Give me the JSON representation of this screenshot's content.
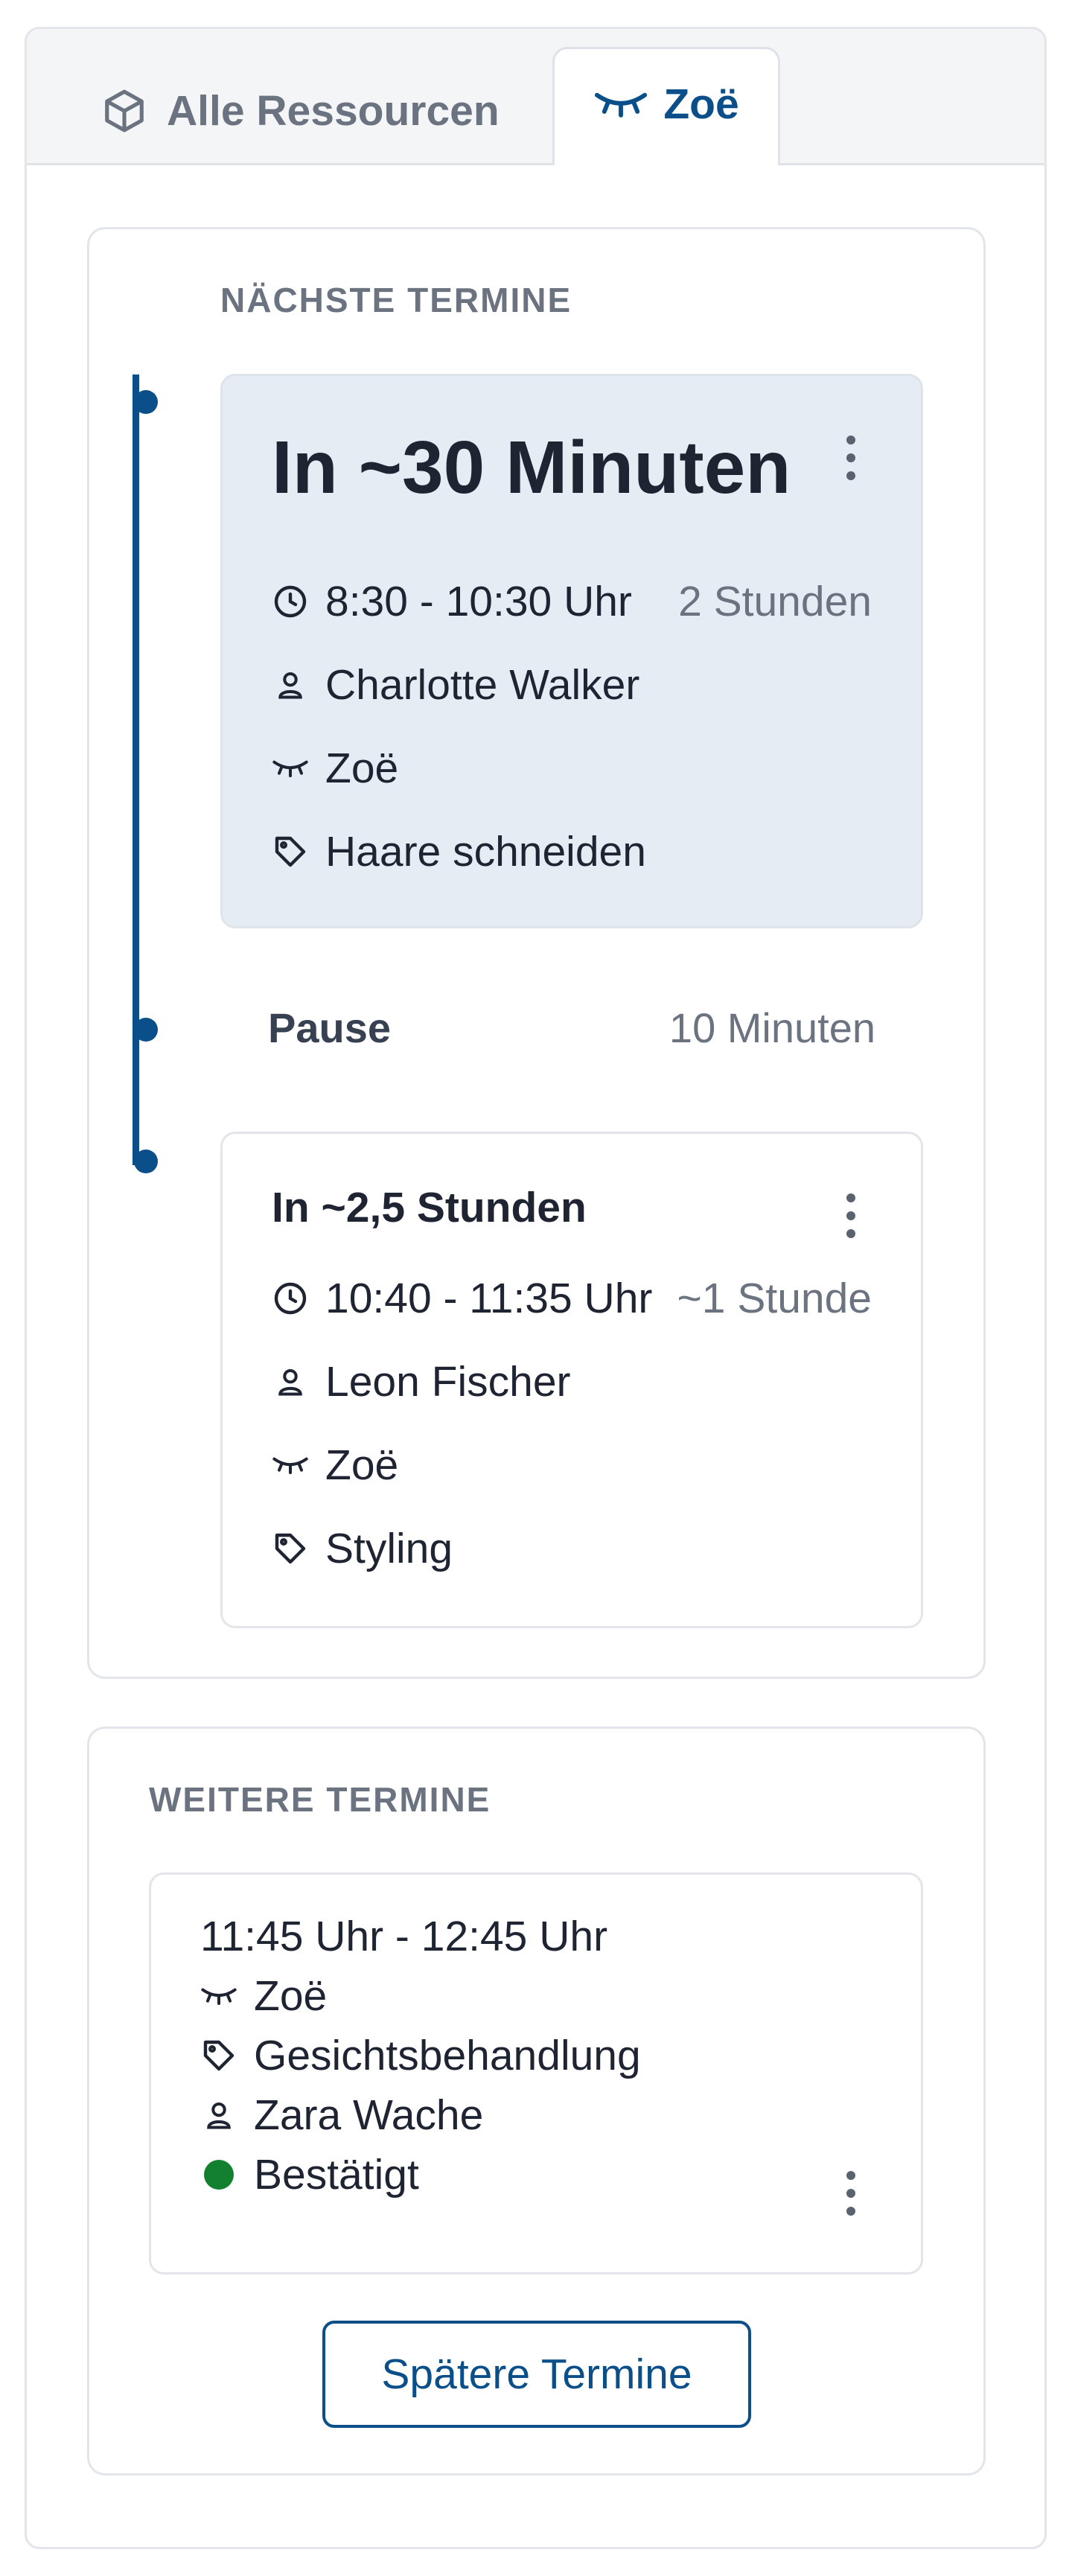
{
  "tabs": {
    "all_label": "Alle Ressourcen",
    "active_label": "Zoë"
  },
  "next_section": {
    "title": "NÄCHSTE TERMINE",
    "first": {
      "heading": "In ~30 Minuten",
      "time": "8:30 - 10:30 Uhr",
      "duration": "2 Stunden",
      "customer": "Charlotte Walker",
      "resource": "Zoë",
      "service": "Haare schneiden"
    },
    "pause": {
      "label": "Pause",
      "duration": "10 Minuten"
    },
    "second": {
      "heading": "In ~2,5 Stunden",
      "time": "10:40 - 11:35 Uhr",
      "duration": "~1 Stunde",
      "customer": "Leon Fischer",
      "resource": "Zoë",
      "service": "Styling"
    }
  },
  "more_section": {
    "title": "WEITERE TERMINE",
    "item": {
      "time": "11:45 Uhr - 12:45 Uhr",
      "resource": "Zoë",
      "service": "Gesichtsbehandlung",
      "customer": "Zara Wache",
      "status": "Bestätigt"
    },
    "button_label": "Spätere Termine"
  },
  "colors": {
    "accent": "#0a4f8a",
    "next_card_bg": "#e6ecf3",
    "status_confirmed": "#12802e",
    "muted_text": "#6b7280"
  },
  "icons": [
    "box-icon",
    "eye-closed-icon",
    "clock-icon",
    "user-icon",
    "tag-icon",
    "more-vertical-icon"
  ]
}
